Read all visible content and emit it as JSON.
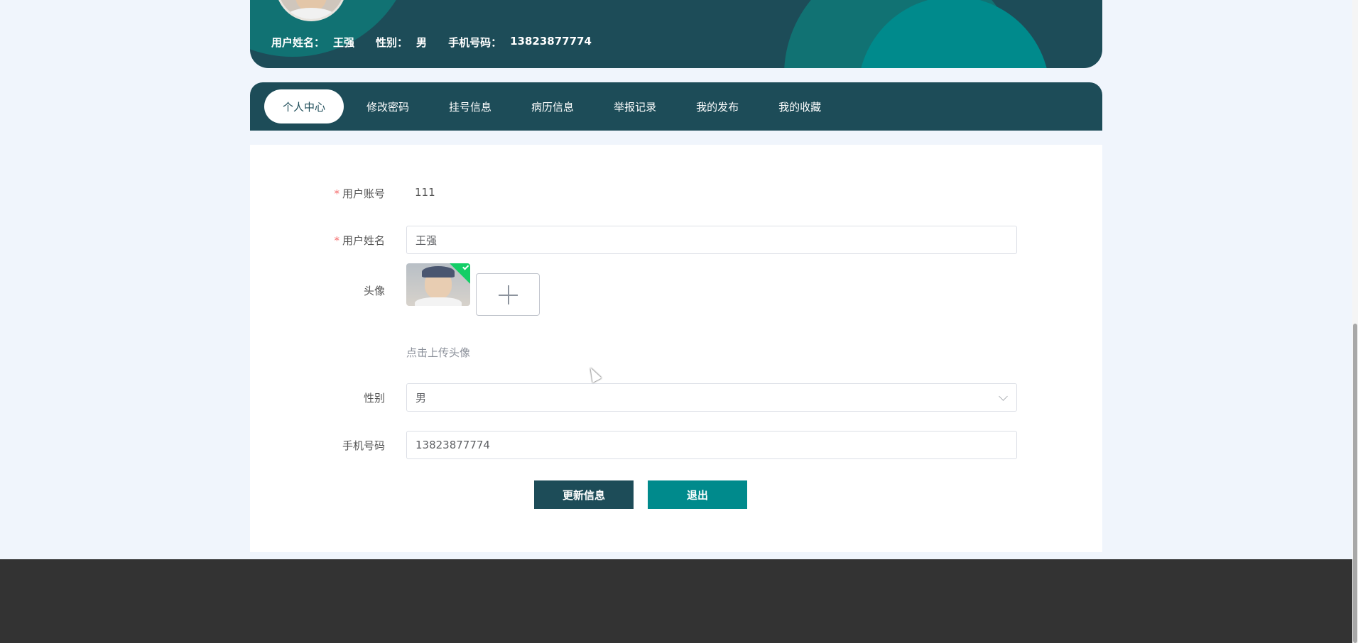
{
  "profile": {
    "name_label": "用户姓名：",
    "name_value": "王强",
    "gender_label": "性别：",
    "gender_value": "男",
    "phone_label": "手机号码：",
    "phone_value": "13823877774"
  },
  "tabs": [
    {
      "label": "个人中心",
      "active": true
    },
    {
      "label": "修改密码",
      "active": false
    },
    {
      "label": "挂号信息",
      "active": false
    },
    {
      "label": "病历信息",
      "active": false
    },
    {
      "label": "举报记录",
      "active": false
    },
    {
      "label": "我的发布",
      "active": false
    },
    {
      "label": "我的收藏",
      "active": false
    }
  ],
  "form": {
    "required_mark": "*",
    "account_label": "用户账号",
    "account_value": "111",
    "name_label": "用户姓名",
    "name_value": "王强",
    "avatar_label": "头像",
    "upload_hint": "点击上传头像",
    "gender_label": "性别",
    "gender_value": "男",
    "phone_label": "手机号码",
    "phone_value": "13823877774"
  },
  "buttons": {
    "update": "更新信息",
    "logout": "退出"
  },
  "colors": {
    "primary_dark": "#1d4c58",
    "primary_teal": "#008a8c",
    "required": "#f56c6c",
    "footer": "#333333",
    "page_bg": "#f0f5fc"
  }
}
